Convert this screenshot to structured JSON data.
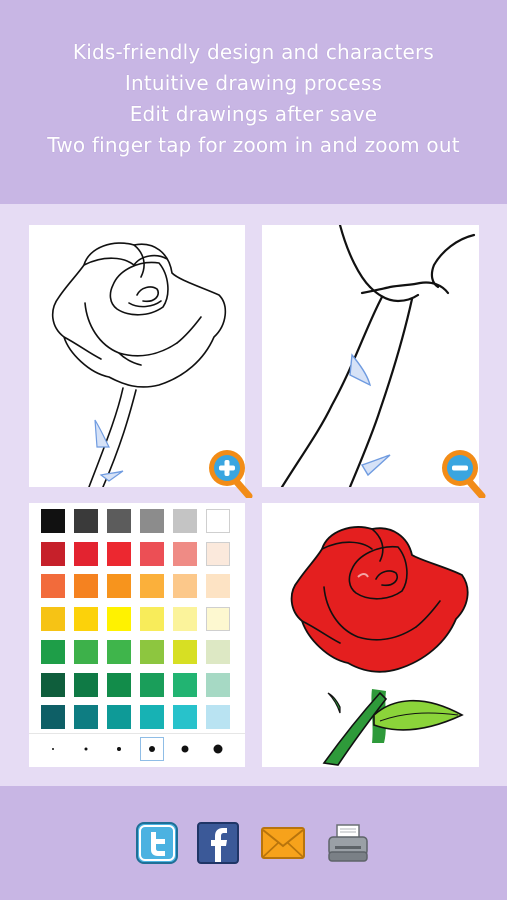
{
  "header": {
    "lines": [
      "Kids-friendly design and characters",
      "Intuitive drawing process",
      "Edit drawings after save",
      "Two finger tap for zoom in and zoom out"
    ]
  },
  "panels": {
    "top_left": {
      "kind": "outline-drawing",
      "icon": "zoom-in-icon"
    },
    "top_right": {
      "kind": "zoomed-outline-drawing",
      "icon": "zoom-out-icon"
    },
    "bottom_left": {
      "kind": "color-palette",
      "palette": [
        [
          "#111111",
          "#3a3a3a",
          "#5c5c5c",
          "#8c8c8c",
          "#c4c4c4",
          "#ffffff"
        ],
        [
          "#c6202a",
          "#e32330",
          "#ec2830",
          "#ec4f55",
          "#ef8b85",
          "#fbe9dc"
        ],
        [
          "#f26b3b",
          "#f58220",
          "#f7941d",
          "#fbb03b",
          "#fcc88a",
          "#fde3c4"
        ],
        [
          "#f6c315",
          "#fcd20a",
          "#fff200",
          "#f8ec5a",
          "#fbf39b",
          "#fdf8d0"
        ],
        [
          "#1e9e48",
          "#3db14a",
          "#3fb54b",
          "#8dc63f",
          "#d7df23",
          "#dde8c4"
        ],
        [
          "#0f5e3c",
          "#0f7a45",
          "#128c4a",
          "#1a9e5a",
          "#22b472",
          "#a6d9c4"
        ],
        [
          "#0e5f66",
          "#0e7d82",
          "#0e9a97",
          "#17b2b4",
          "#28c2cb",
          "#b9e3f2"
        ]
      ],
      "brush_sizes": [
        2,
        3,
        4,
        6,
        7,
        9
      ],
      "selected_brush_index": 3
    },
    "bottom_right": {
      "kind": "colored-drawing"
    }
  },
  "share": {
    "buttons": [
      "twitter",
      "facebook",
      "email",
      "print"
    ],
    "colors": {
      "twitter": "#4bb2e1",
      "facebook": "#3b5998",
      "email": "#f7a21b",
      "print": "#8a8f95"
    }
  },
  "colors": {
    "header_bg": "#c8b6e4",
    "main_bg": "#e6dcf4",
    "zoom_orange": "#f28c17",
    "zoom_blue": "#3aa5e0"
  }
}
